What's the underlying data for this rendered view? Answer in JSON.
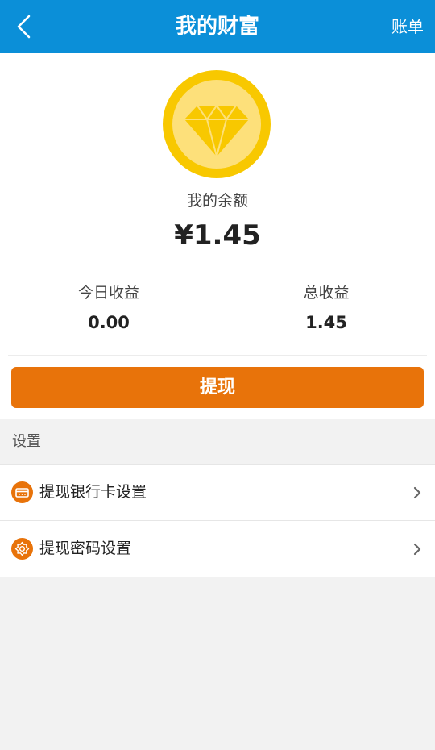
{
  "header": {
    "title": "我的财富",
    "bill_label": "账单"
  },
  "balance": {
    "label": "我的余额",
    "value": "¥1.45"
  },
  "stats": {
    "today": {
      "label": "今日收益",
      "value": "0.00"
    },
    "total": {
      "label": "总收益",
      "value": "1.45"
    }
  },
  "withdraw_button": "提现",
  "settings": {
    "section_title": "设置",
    "items": [
      {
        "label": "提现银行卡设置",
        "icon": "bank-card-icon"
      },
      {
        "label": "提现密码设置",
        "icon": "password-gear-icon"
      }
    ]
  },
  "colors": {
    "header_bg": "#0b8fd8",
    "accent_orange": "#e8730a",
    "coin_gold": "#f8c800",
    "page_bg": "#f2f2f2"
  }
}
